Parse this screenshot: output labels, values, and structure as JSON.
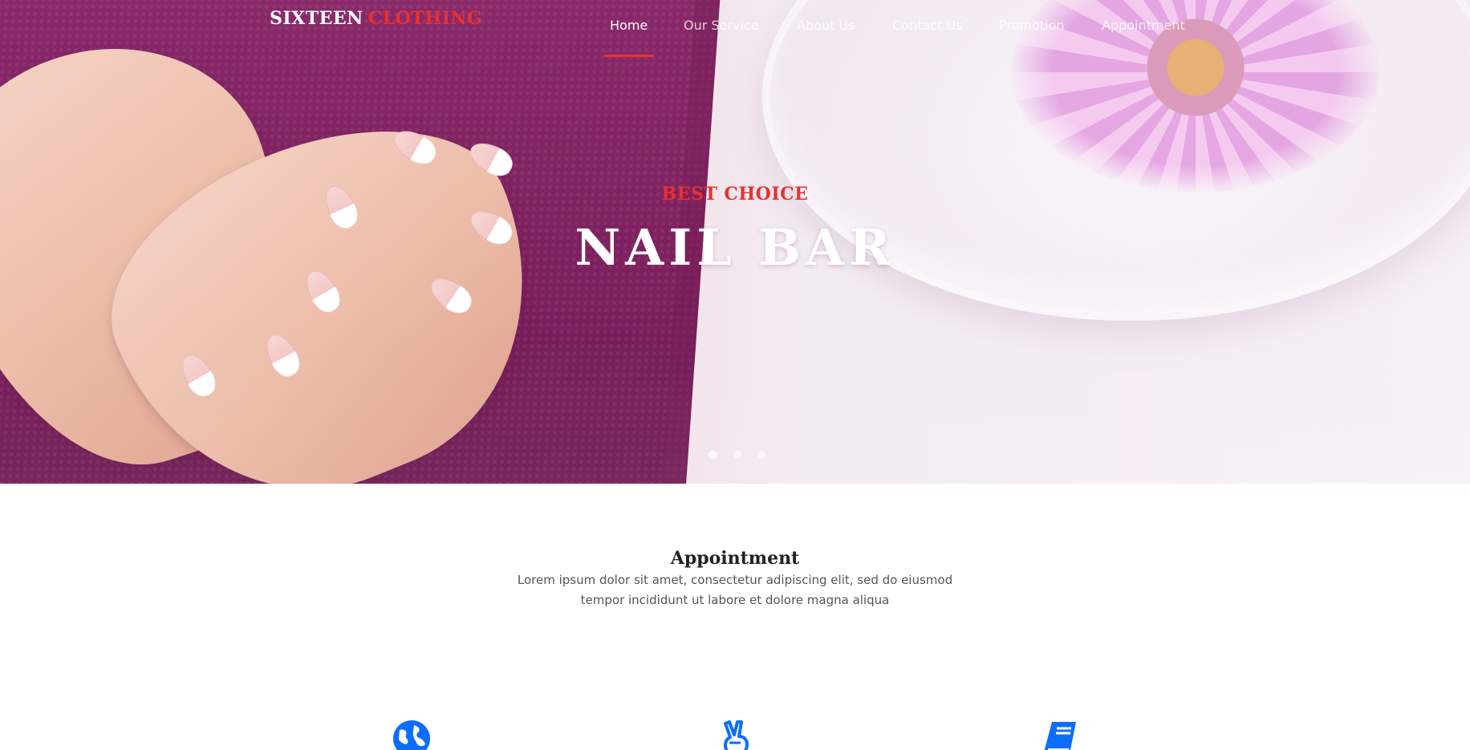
{
  "header": {
    "logo_part1": "SIXTEEN",
    "logo_part2": "CLOTHING",
    "nav": [
      {
        "label": "Home",
        "active": true
      },
      {
        "label": "Our Service",
        "active": false
      },
      {
        "label": "About Us",
        "active": false
      },
      {
        "label": "Contact Us",
        "active": false
      },
      {
        "label": "Promotion",
        "active": false
      },
      {
        "label": "Appointment",
        "active": false
      }
    ]
  },
  "hero": {
    "kicker": "BEST CHOICE",
    "title": "NAIL BAR",
    "slide_count": 3,
    "active_slide": 1
  },
  "appointment": {
    "title": "Appointment",
    "description": "Lorem ipsum dolor sit amet, consectetur adipiscing elit, sed do eiusmod tempor incididunt ut labore et dolore magna aliqua"
  },
  "features": [
    {
      "icon": "globe-icon"
    },
    {
      "icon": "peace-hand-icon"
    },
    {
      "icon": "book-icon"
    }
  ],
  "colors": {
    "accent_red": "#e8322e",
    "icon_blue": "#0d6efd",
    "towel_purple": "#7b1f5e"
  }
}
